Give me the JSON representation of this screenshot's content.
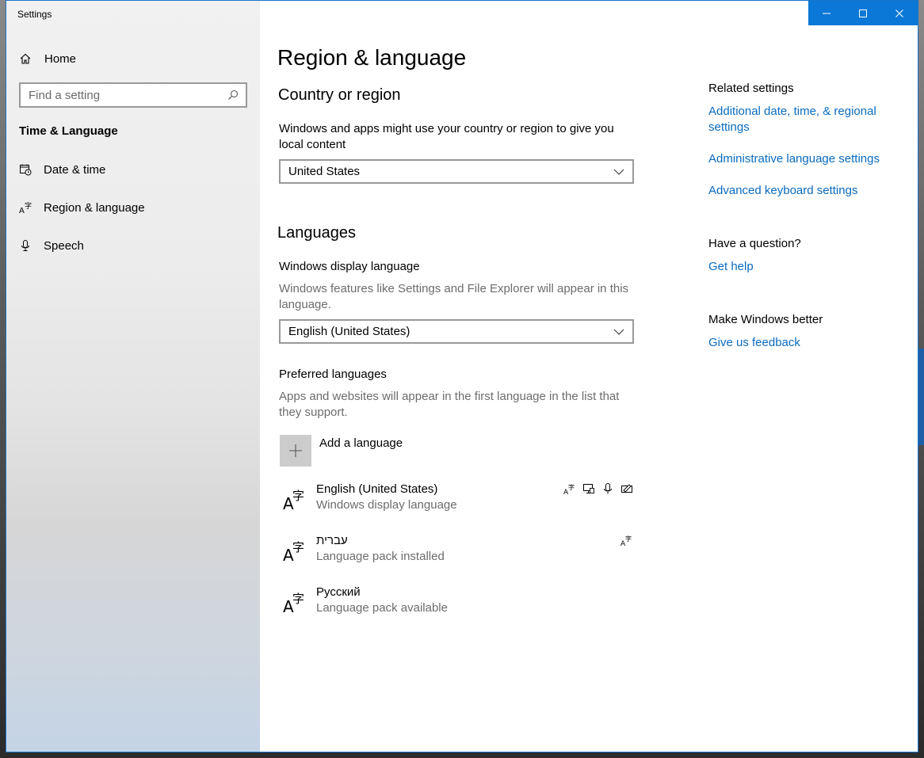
{
  "window": {
    "title": "Settings"
  },
  "sidebar": {
    "home_label": "Home",
    "search_placeholder": "Find a setting",
    "section_title": "Time & Language",
    "items": [
      {
        "label": "Date & time",
        "icon": "calendar-clock-icon"
      },
      {
        "label": "Region & language",
        "icon": "language-icon"
      },
      {
        "label": "Speech",
        "icon": "microphone-icon"
      }
    ]
  },
  "main": {
    "title": "Region & language",
    "country": {
      "heading": "Country or region",
      "description": "Windows and apps might use your country or region to give you local content",
      "selected": "United States"
    },
    "languages": {
      "heading": "Languages",
      "display_label": "Windows display language",
      "display_description": "Windows features like Settings and File Explorer will appear in this language.",
      "display_selected": "English (United States)",
      "preferred_label": "Preferred languages",
      "preferred_description": "Apps and websites will appear in the first language in the list that they support.",
      "add_label": "Add a language",
      "list": [
        {
          "name": "English (United States)",
          "status": "Windows display language",
          "features": [
            "language-pack-icon",
            "display-icon",
            "speech-icon",
            "handwriting-icon"
          ]
        },
        {
          "name": "עברית",
          "status": "Language pack installed",
          "features": [
            "language-pack-icon"
          ]
        },
        {
          "name": "Русский",
          "status": "Language pack available",
          "features": []
        }
      ]
    }
  },
  "related": {
    "heading": "Related settings",
    "links": [
      "Additional date, time, & regional settings",
      "Administrative language settings",
      "Advanced keyboard settings"
    ],
    "question_heading": "Have a question?",
    "help_link": "Get help",
    "better_heading": "Make Windows better",
    "feedback_link": "Give us feedback"
  },
  "colors": {
    "accent": "#0b78d7",
    "link": "#0a6bbf",
    "muted": "#6d6d6d"
  }
}
